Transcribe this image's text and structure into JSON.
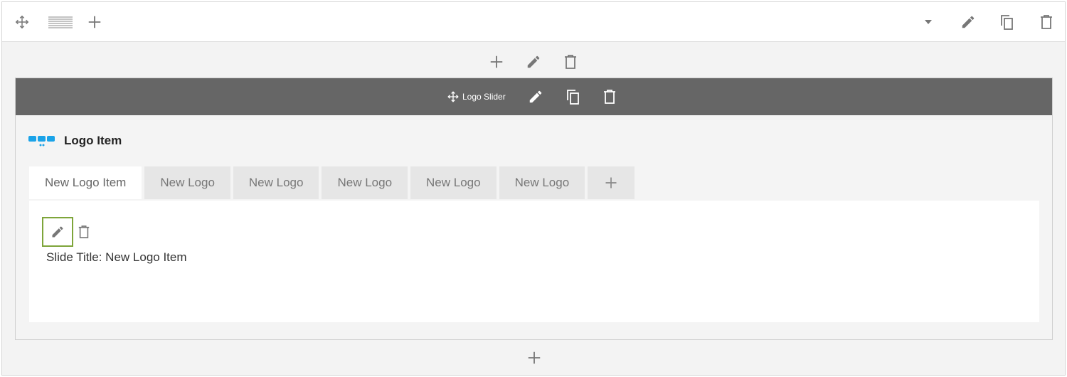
{
  "row_toolbar": {
    "icons": [
      "move-icon",
      "layout-icon",
      "add-icon",
      "caret-down-icon",
      "pencil-icon",
      "copy-icon",
      "trash-icon"
    ]
  },
  "column_toolbar": {
    "icons": [
      "add-icon",
      "pencil-icon",
      "trash-icon"
    ]
  },
  "module": {
    "title": "Logo Slider",
    "icons": [
      "move-icon",
      "pencil-icon",
      "copy-icon",
      "trash-icon"
    ]
  },
  "logo_item": {
    "heading": "Logo Item",
    "icon": "logo-grid-icon",
    "accent": "#1aa3e8"
  },
  "tabs": [
    {
      "label": "New Logo Item",
      "active": true
    },
    {
      "label": "New Logo",
      "active": false
    },
    {
      "label": "New Logo",
      "active": false
    },
    {
      "label": "New Logo",
      "active": false
    },
    {
      "label": "New Logo",
      "active": false
    },
    {
      "label": "New Logo",
      "active": false
    }
  ],
  "tab_content": {
    "slide_title_label": "Slide Title:",
    "slide_title_value": "New Logo Item"
  },
  "colors": {
    "module_bar": "#666666",
    "edit_border": "#7ea53a",
    "icon_gray": "#777777"
  }
}
